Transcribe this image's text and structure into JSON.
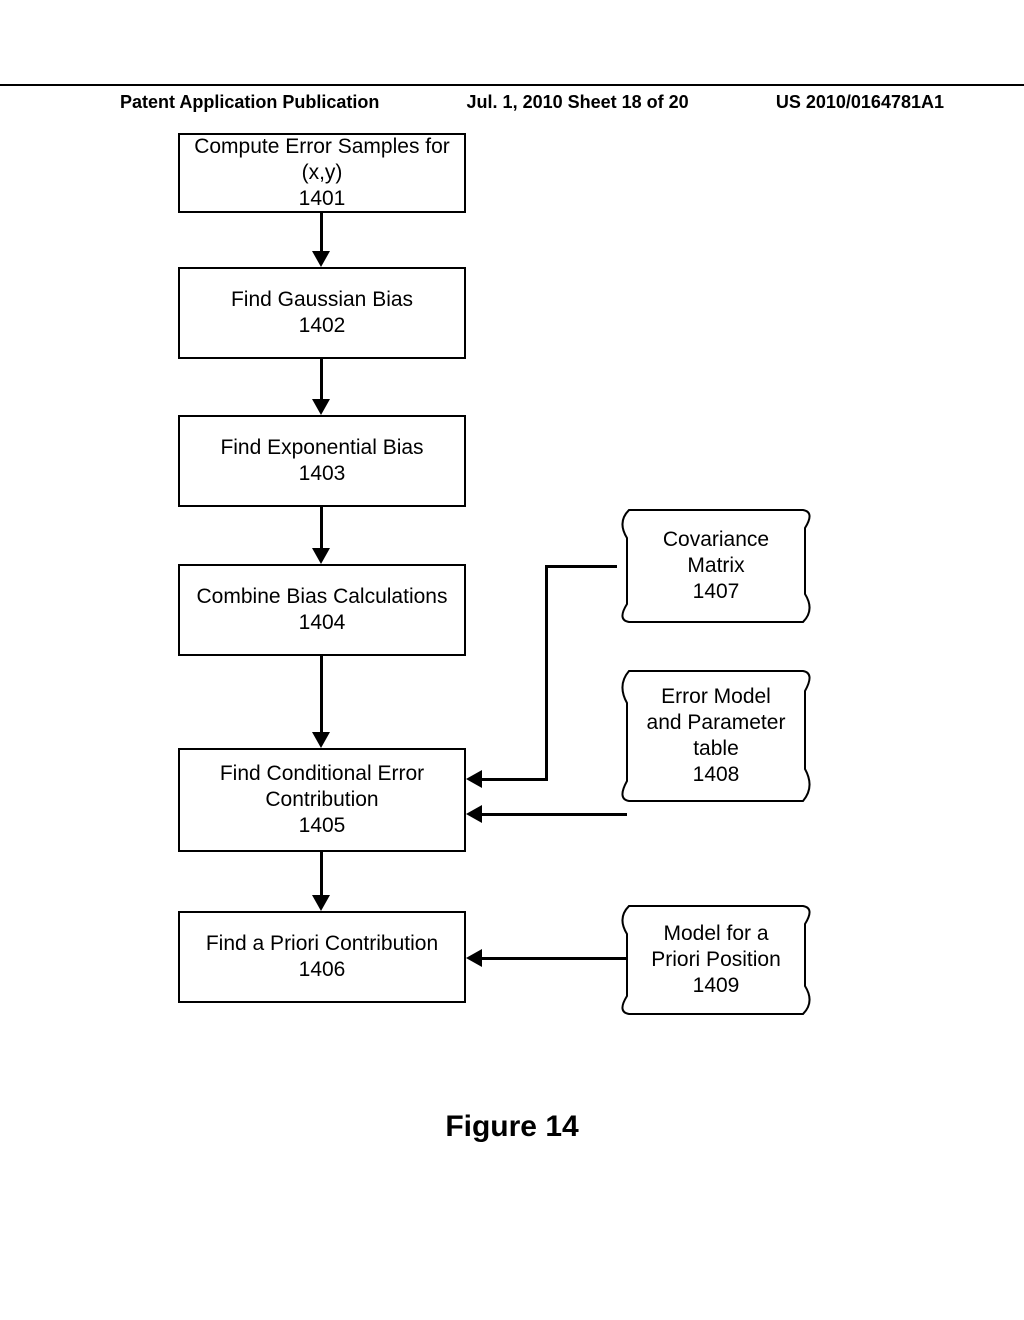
{
  "header": {
    "left": "Patent Application Publication",
    "middle": "Jul. 1, 2010  Sheet 18 of 20",
    "right": "US 2010/0164781A1"
  },
  "boxes": {
    "b1401": {
      "line1": "Compute Error Samples for",
      "line2": "(x,y)",
      "num": "1401"
    },
    "b1402": {
      "line1": "Find Gaussian Bias",
      "num": "1402"
    },
    "b1403": {
      "line1": "Find Exponential Bias",
      "num": "1403"
    },
    "b1404": {
      "line1": "Combine Bias Calculations",
      "num": "1404"
    },
    "b1405": {
      "line1": "Find Conditional Error",
      "line2": "Contribution",
      "num": "1405"
    },
    "b1406": {
      "line1": "Find a Priori Contribution",
      "num": "1406"
    }
  },
  "docs": {
    "d1407": {
      "line1": "Covariance",
      "line2": "Matrix",
      "num": "1407"
    },
    "d1408": {
      "line1": "Error Model",
      "line2": "and Parameter",
      "line3": "table",
      "num": "1408"
    },
    "d1409": {
      "line1": "Model for a",
      "line2": "Priori Position",
      "num": "1409"
    }
  },
  "caption": "Figure 14",
  "chart_data": {
    "type": "flowchart",
    "nodes": [
      {
        "id": "1401",
        "label": "Compute Error Samples for (x,y)",
        "shape": "process"
      },
      {
        "id": "1402",
        "label": "Find Gaussian Bias",
        "shape": "process"
      },
      {
        "id": "1403",
        "label": "Find Exponential Bias",
        "shape": "process"
      },
      {
        "id": "1404",
        "label": "Combine Bias Calculations",
        "shape": "process"
      },
      {
        "id": "1405",
        "label": "Find Conditional Error Contribution",
        "shape": "process"
      },
      {
        "id": "1406",
        "label": "Find a Priori Contribution",
        "shape": "process"
      },
      {
        "id": "1407",
        "label": "Covariance Matrix",
        "shape": "document-input"
      },
      {
        "id": "1408",
        "label": "Error Model and Parameter table",
        "shape": "document-input"
      },
      {
        "id": "1409",
        "label": "Model for a Priori Position",
        "shape": "document-input"
      }
    ],
    "edges": [
      {
        "from": "1401",
        "to": "1402"
      },
      {
        "from": "1402",
        "to": "1403"
      },
      {
        "from": "1403",
        "to": "1404"
      },
      {
        "from": "1404",
        "to": "1405"
      },
      {
        "from": "1405",
        "to": "1406"
      },
      {
        "from": "1407",
        "to": "1405"
      },
      {
        "from": "1408",
        "to": "1405"
      },
      {
        "from": "1409",
        "to": "1406"
      }
    ],
    "title": "Figure 14"
  }
}
